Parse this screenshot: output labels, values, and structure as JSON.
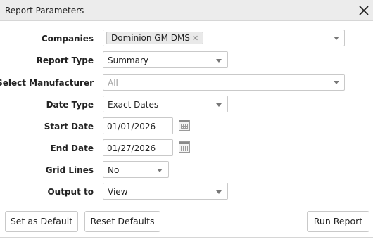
{
  "dialog": {
    "title": "Report Parameters"
  },
  "fields": {
    "companies": {
      "label": "Companies",
      "tags": [
        "Dominion GM DMS"
      ]
    },
    "report_type": {
      "label": "Report Type",
      "value": "Summary"
    },
    "manufacturer": {
      "label": "Select Manufacturer",
      "placeholder": "All"
    },
    "date_type": {
      "label": "Date Type",
      "value": "Exact Dates"
    },
    "start_date": {
      "label": "Start Date",
      "value": "01/01/2026"
    },
    "end_date": {
      "label": "End Date",
      "value": "01/27/2026"
    },
    "grid_lines": {
      "label": "Grid Lines",
      "value": "No"
    },
    "output_to": {
      "label": "Output to",
      "value": "View"
    }
  },
  "buttons": {
    "set_default": "Set as Default",
    "reset_defaults": "Reset Defaults",
    "run_report": "Run Report"
  },
  "icons": {
    "close": "close-icon",
    "calendar": "calendar-icon",
    "dropdown": "chevron-down-icon",
    "tag_remove": "tag-remove-icon"
  }
}
